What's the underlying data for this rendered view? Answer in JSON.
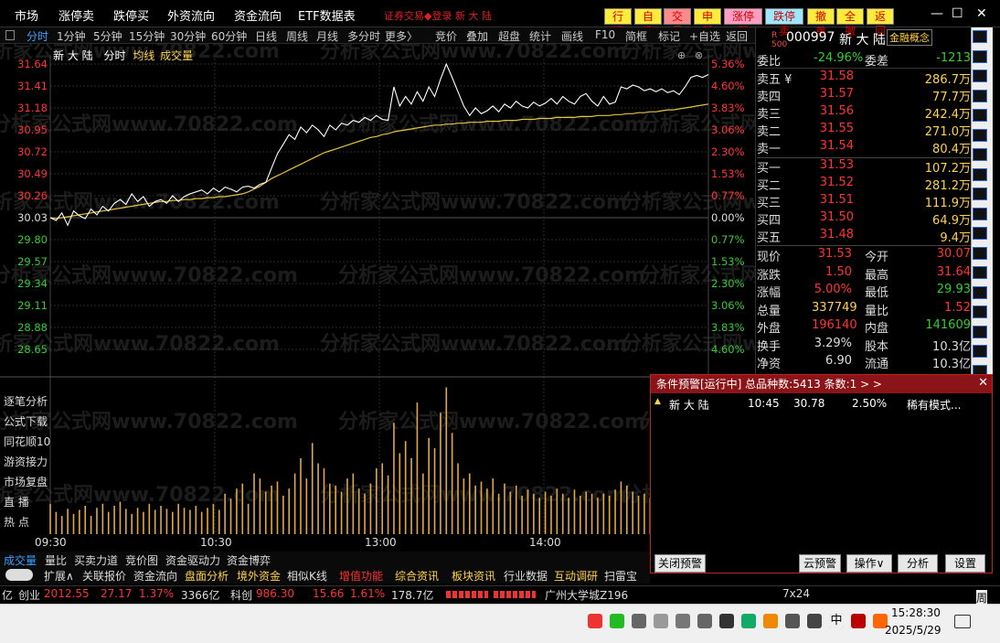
{
  "menu": [
    "市场",
    "涨停卖",
    "跌停买",
    "外资流向",
    "资金流向",
    "ETF数据表"
  ],
  "top_hint": "证券交易◆登录 新 大 陆",
  "quick_buttons": [
    {
      "label": "行情",
      "bg": "#ffeb3b",
      "fg": "#c00"
    },
    {
      "label": "自选",
      "bg": "#ffeb3b",
      "fg": "#c00"
    },
    {
      "label": "交易",
      "bg": "#ff8a8a",
      "fg": "#c00"
    },
    {
      "label": "申新",
      "bg": "#ffeb3b",
      "fg": "#c00"
    },
    {
      "label": "涨停买",
      "bg": "#ff9ec2",
      "fg": "#c00"
    },
    {
      "label": "跌停卖",
      "bg": "#9ee8ff",
      "fg": "#c00"
    },
    {
      "label": "撤单",
      "bg": "#ffeb3b",
      "fg": "#c00"
    },
    {
      "label": "全撤",
      "bg": "#ffeb3b",
      "fg": "#c00"
    },
    {
      "label": "返回",
      "bg": "#ffeb3b",
      "fg": "#c00"
    }
  ],
  "window_controls": [
    "—",
    "☐",
    "✕"
  ],
  "toolbar": [
    "分时",
    "1分钟",
    "5分钟",
    "15分钟",
    "30分钟",
    "60分钟",
    "日线",
    "周线",
    "月线",
    "多分时",
    "更多〉",
    "竞价",
    "叠加",
    "超盘",
    "统计",
    "画线",
    "F10",
    "简框",
    "标记",
    "+自选",
    "返回"
  ],
  "chart_header": {
    "name": "新 大 陆",
    "mode": "分时",
    "ma": "均线",
    "vol": "成交量"
  },
  "chart_data": {
    "type": "line",
    "title": "新 大 陆 分时",
    "prev_close": 30.03,
    "y_ticks_left": [
      "31.64",
      "31.41",
      "31.18",
      "30.95",
      "30.72",
      "30.49",
      "30.26",
      "30.03",
      "29.80",
      "29.57",
      "29.34",
      "29.11",
      "28.88",
      "28.65"
    ],
    "y_ticks_right": [
      "5.36%",
      "4.60%",
      "3.83%",
      "3.06%",
      "2.30%",
      "1.53%",
      "0.77%",
      "0.00%",
      "0.77%",
      "1.53%",
      "2.30%",
      "3.06%",
      "3.83%",
      "4.60%"
    ],
    "x_ticks": [
      "09:30",
      "10:30",
      "13:00",
      "14:00"
    ],
    "price": [
      30.03,
      30.0,
      30.08,
      29.95,
      30.1,
      30.05,
      30.02,
      30.12,
      30.06,
      30.15,
      30.1,
      30.18,
      30.22,
      30.17,
      30.28,
      30.2,
      30.25,
      30.15,
      30.2,
      30.22,
      30.18,
      30.26,
      30.2,
      30.25,
      30.28,
      30.3,
      30.32,
      30.28,
      30.34,
      30.3,
      30.35,
      30.33,
      30.3,
      30.35,
      30.36,
      30.34,
      30.38,
      30.4,
      30.55,
      30.7,
      30.8,
      30.9,
      30.85,
      30.98,
      30.92,
      31.0,
      30.95,
      30.88,
      31.0,
      30.95,
      31.02,
      31.0,
      31.05,
      31.03,
      31.08,
      31.05,
      31.1,
      31.06,
      31.05,
      31.4,
      31.2,
      31.3,
      31.22,
      31.35,
      31.25,
      31.4,
      31.3,
      31.48,
      31.64,
      31.5,
      31.35,
      31.2,
      31.1,
      31.18,
      31.12,
      31.15,
      31.2,
      31.14,
      31.22,
      31.18,
      31.25,
      31.2,
      31.18,
      31.24,
      31.2,
      31.23,
      31.28,
      31.22,
      31.3,
      31.25,
      31.22,
      31.3,
      31.33,
      31.25,
      31.2,
      31.3,
      31.22,
      31.24,
      31.4,
      31.38,
      31.42,
      31.4,
      31.36,
      31.38,
      31.35,
      31.38,
      31.34,
      31.36,
      31.32,
      31.4,
      31.5,
      31.52,
      31.5,
      31.53
    ],
    "avg": [
      30.03,
      30.02,
      30.03,
      30.04,
      30.05,
      30.06,
      30.07,
      30.08,
      30.09,
      30.1,
      30.11,
      30.12,
      30.13,
      30.14,
      30.15,
      30.16,
      30.17,
      30.18,
      30.19,
      30.2,
      30.2,
      30.21,
      30.21,
      30.22,
      30.22,
      30.23,
      30.23,
      30.24,
      30.24,
      30.25,
      30.25,
      30.26,
      30.27,
      30.28,
      30.3,
      30.33,
      30.36,
      30.4,
      30.44,
      30.47,
      30.5,
      30.53,
      30.56,
      30.59,
      30.62,
      30.65,
      30.68,
      30.71,
      30.73,
      30.75,
      30.77,
      30.79,
      30.81,
      30.83,
      30.85,
      30.87,
      30.88,
      30.9,
      30.91,
      30.93,
      30.94,
      30.95,
      30.96,
      30.97,
      30.98,
      30.99,
      31.0,
      31.0,
      31.01,
      31.01,
      31.02,
      31.02,
      31.03,
      31.03,
      31.03,
      31.04,
      31.04,
      31.04,
      31.05,
      31.05,
      31.05,
      31.06,
      31.06,
      31.06,
      31.07,
      31.07,
      31.07,
      31.08,
      31.08,
      31.08,
      31.08,
      31.09,
      31.09,
      31.09,
      31.1,
      31.1,
      31.1,
      31.11,
      31.11,
      31.12,
      31.12,
      31.13,
      31.13,
      31.14,
      31.14,
      31.15,
      31.16,
      31.16,
      31.17,
      31.18,
      31.19,
      31.2,
      31.21,
      31.22
    ],
    "volume": [
      30,
      22,
      18,
      25,
      20,
      24,
      28,
      18,
      26,
      30,
      22,
      28,
      32,
      25,
      20,
      26,
      22,
      30,
      24,
      28,
      25,
      22,
      30,
      26,
      24,
      28,
      22,
      26,
      30,
      24,
      40,
      35,
      45,
      50,
      30,
      60,
      55,
      42,
      48,
      52,
      38,
      45,
      60,
      75,
      55,
      90,
      70,
      65,
      50,
      48,
      42,
      55,
      60,
      45,
      40,
      50,
      65,
      70,
      58,
      110,
      80,
      92,
      75,
      130,
      60,
      95,
      85,
      120,
      145,
      100,
      70,
      55,
      60,
      48,
      52,
      45,
      55,
      40,
      50,
      42,
      48,
      38,
      44,
      40,
      36,
      42,
      38,
      45,
      40,
      36,
      44,
      38,
      42,
      40,
      36,
      40,
      38,
      44,
      52,
      48,
      42,
      38,
      40,
      36,
      38,
      34,
      36,
      40,
      38,
      45,
      50,
      48,
      42,
      40
    ]
  },
  "left_nav": [
    "逐笔分析",
    "公式下载",
    "同花顺10",
    "游资接力",
    "市场复盘",
    "直  播",
    "热  点"
  ],
  "bottom_tabs_1": [
    "成交量",
    "量比",
    "买卖力道",
    "竞价图",
    "资金驱动力",
    "资金博弈"
  ],
  "bottom_tabs_2": [
    "扩展∧",
    "关联报价",
    "资金流向",
    "盘面分析",
    "境外资金",
    "相似K线",
    "增值功能",
    "综合资讯",
    "板块资讯",
    "行业数据",
    "互动调研",
    "扫雷宝"
  ],
  "quote": {
    "code": "000997",
    "name": "新 大 陆",
    "concept": "金融概念",
    "webi": {
      "label": "委比",
      "value": "-24.96%",
      "label2": "委差",
      "value2": "-1213"
    },
    "asks": [
      {
        "label": "卖五 ¥",
        "price": "31.58",
        "vol": "286.7万"
      },
      {
        "label": "卖四",
        "price": "31.57",
        "vol": "77.7万"
      },
      {
        "label": "卖三",
        "price": "31.56",
        "vol": "242.4万"
      },
      {
        "label": "卖二",
        "price": "31.55",
        "vol": "271.0万"
      },
      {
        "label": "卖一",
        "price": "31.54",
        "vol": "80.4万"
      }
    ],
    "bids": [
      {
        "label": "买一",
        "price": "31.53",
        "vol": "107.2万"
      },
      {
        "label": "买二",
        "price": "31.52",
        "vol": "281.2万"
      },
      {
        "label": "买三",
        "price": "31.51",
        "vol": "111.9万"
      },
      {
        "label": "买四",
        "price": "31.50",
        "vol": "64.9万"
      },
      {
        "label": "买五",
        "price": "31.48",
        "vol": "9.4万"
      }
    ],
    "stats": [
      {
        "l1": "现价",
        "v1": "31.53",
        "c1": "#f33",
        "l2": "今开",
        "v2": "30.07",
        "c2": "#f33"
      },
      {
        "l1": "涨跌",
        "v1": "1.50",
        "c1": "#f33",
        "l2": "最高",
        "v2": "31.64",
        "c2": "#f33"
      },
      {
        "l1": "涨幅",
        "v1": "5.00%",
        "c1": "#f33",
        "l2": "最低",
        "v2": "29.93",
        "c2": "#3c3"
      },
      {
        "l1": "总量",
        "v1": "337749",
        "c1": "#ffd24a",
        "l2": "量比",
        "v2": "1.52",
        "c2": "#f33"
      },
      {
        "l1": "外盘",
        "v1": "196140",
        "c1": "#f33",
        "l2": "内盘",
        "v2": "141609",
        "c2": "#3c3"
      },
      {
        "l1": "换手",
        "v1": "3.29%",
        "c1": "#ddd",
        "l2": "股本",
        "v2": "10.3亿",
        "c2": "#ddd"
      },
      {
        "l1": "净资",
        "v1": "6.90",
        "c1": "#ddd",
        "l2": "流通",
        "v2": "10.3亿",
        "c2": "#ddd"
      }
    ]
  },
  "alert": {
    "title": "条件预警[运行中] 总品种数:5413 条数:1  > >",
    "row": {
      "name": "新 大 陆",
      "time": "10:45",
      "price": "30.78",
      "pct": "2.50%",
      "desc": "稀有模式..."
    },
    "buttons": [
      "关闭预警",
      "云预警",
      "操作∨",
      "分析",
      "设置"
    ]
  },
  "statusbar": {
    "prefix": "亿",
    "cy_label": "创业",
    "cy_val": "2012.55",
    "cy_chg": "27.17",
    "cy_pct": "1.37%",
    "cy_amt": "3366亿",
    "kc_label": "科创",
    "kc_val": "986.30",
    "kc_chg": "15.66",
    "kc_pct": "1.61%",
    "kc_amt": "178.7亿",
    "ticker": "广州大学城Z196",
    "extra": "7x24"
  },
  "taskbar": {
    "time": "15:28:30",
    "date": "2025/5/29",
    "ime": "中",
    "week": "周"
  },
  "watermark": "分析家公式网www.70822.com"
}
